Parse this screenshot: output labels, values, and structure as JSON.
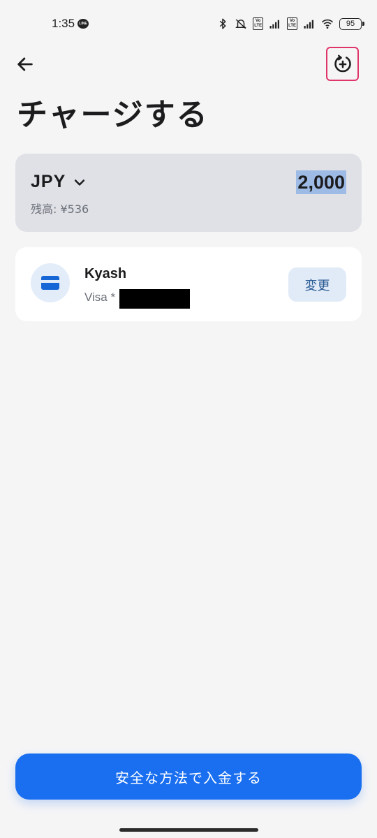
{
  "status_bar": {
    "time": "1:35",
    "line_badge": "LINE",
    "volte_label": "Vo\nLTE",
    "battery": "95",
    "icons": [
      "bluetooth-icon",
      "mute-icon",
      "volte-icon",
      "signal-icon",
      "volte-icon",
      "signal-icon",
      "wifi-icon",
      "battery-icon"
    ]
  },
  "header": {
    "back_icon": "arrow-left-icon",
    "history_icon": "add-history-icon",
    "title": "チャージする"
  },
  "amount_card": {
    "currency": "JPY",
    "currency_icon": "chevron-down-icon",
    "balance": "残高: ¥536",
    "amount": "2,000"
  },
  "payment_method": {
    "icon": "credit-card-icon",
    "name": "Kyash",
    "number": "Visa *",
    "change_label": "変更"
  },
  "footer": {
    "deposit_label": "安全な方法で入金する"
  },
  "colors": {
    "background": "#f5f5f6",
    "primary": "#1a6ff0",
    "highlight_frame": "#e0356b",
    "amount_card": "#dfe1e6",
    "selection": "#9ebbe6"
  }
}
